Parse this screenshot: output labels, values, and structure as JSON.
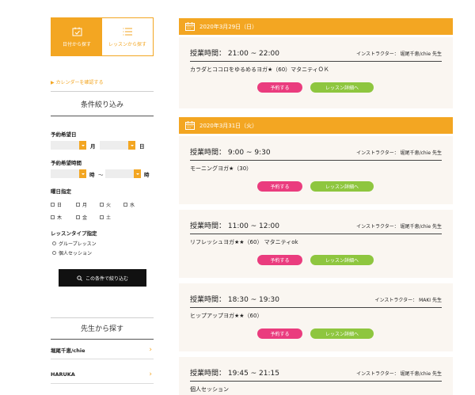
{
  "sidebar": {
    "tabs": [
      {
        "label": "日付から探す",
        "icon": "calendar-check-icon",
        "active": true
      },
      {
        "label": "レッスンから探す",
        "icon": "list-icon",
        "active": false
      }
    ],
    "calendar_link": "▶ カレンダーを確認する",
    "filter_title": "条件絞り込み",
    "date_label": "予約希望日",
    "month_unit": "月",
    "day_unit": "日",
    "time_label": "予約希望時間",
    "hour_unit": "時",
    "tilde": "〜",
    "hour_unit2": "時",
    "weekday_label": "曜日指定",
    "weekdays": [
      "日",
      "月",
      "火",
      "水",
      "木",
      "金",
      "土"
    ],
    "lesson_type_label": "レッスンタイプ指定",
    "lesson_types": [
      "グループレッスン",
      "個人セッション"
    ],
    "search_button": "この条件で絞り込む",
    "teacher_title": "先生から探す",
    "teachers": [
      "堀尾千恵/chie",
      "HARUKA"
    ]
  },
  "main": {
    "days": [
      {
        "date": "2020年3月29日（日）"
      },
      {
        "date": "2020年3月31日（火）"
      }
    ],
    "lessons": [
      {
        "time": "授業時間： 21:00 ~ 22:00",
        "instructor": "インストラクター： 堀尾千恵/chie 先生",
        "name": "カラダとココロをゆるめるヨガ★（60）マタニティＯＫ"
      },
      {
        "time": "授業時間： 9:00 ~ 9:30",
        "instructor": "インストラクター： 堀尾千恵/chie 先生",
        "name": "モーニングヨガ★（30）"
      },
      {
        "time": "授業時間： 11:00 ~ 12:00",
        "instructor": "インストラクター： 堀尾千恵/chie 先生",
        "name": "リフレッシュヨガ★★（60） マタニティok"
      },
      {
        "time": "授業時間： 18:30 ~ 19:30",
        "instructor": "インストラクター： MAKI 先生",
        "name": "ヒップアップヨガ★★（60）"
      },
      {
        "time": "授業時間： 19:45 ~ 21:15",
        "instructor": "インストラクター： 堀尾千恵/chie 先生",
        "name": "個人セッション"
      }
    ],
    "reserve_label": "予約する",
    "detail_label": "レッスン詳細へ"
  },
  "colors": {
    "accent": "#f3a622",
    "reserve": "#ea3c7e",
    "detail": "#8ec63f",
    "card_bg": "#faf6f1"
  }
}
